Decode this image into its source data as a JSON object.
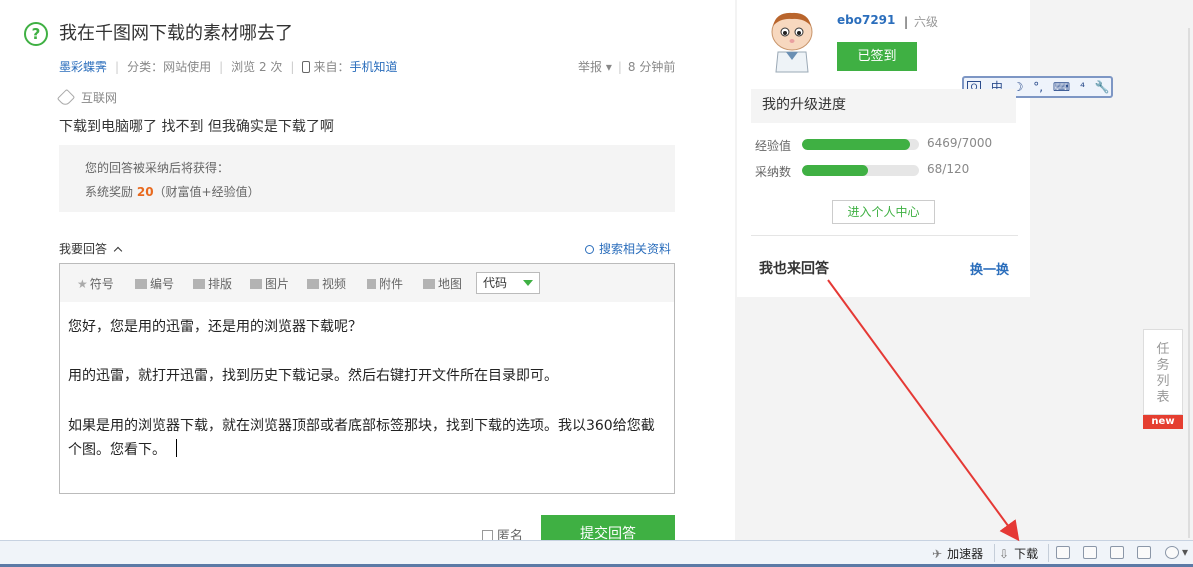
{
  "question": {
    "title": "我在千图网下载的素材哪去了",
    "author": "墨彩蝶霁",
    "category_label": "分类：",
    "category": "网站使用",
    "views": "浏览 2 次",
    "source_label": "来自：",
    "source": "手机知道",
    "report": "举报",
    "time": "8 分钟前",
    "tag": "互联网",
    "body": "下载到电脑哪了 找不到 但我确实是下载了啊"
  },
  "reward": {
    "line1": "您的回答被采纳后将获得：",
    "line2_prefix": "系统奖励",
    "points": "20",
    "line2_suffix": "（财富值+经验值）"
  },
  "answer": {
    "label": "我要回答",
    "search_related": "搜索相关资料",
    "toolbar": [
      "符号",
      "编号",
      "排版",
      "图片",
      "视频",
      "附件",
      "地图"
    ],
    "code_select": "代码",
    "lines": [
      "您好，您是用的迅雷，还是用的浏览器下载呢？",
      "用的迅雷，就打开迅雷，找到历史下载记录。然后右键打开文件所在目录即可。",
      "如果是用的浏览器下载，就在浏览器顶部或者底部标签那块，找到下载的选项。我以360给您截",
      "个图。您看下。"
    ],
    "anonymous": "匿名",
    "submit": "提交回答"
  },
  "user": {
    "name": "ebo7291",
    "level": "六级",
    "signed": "已签到"
  },
  "ime": {
    "items": [
      "中",
      "☽",
      "°,",
      "⌨",
      "⁴",
      "🔧"
    ]
  },
  "progress": {
    "title": "我的升级进度",
    "rows": [
      {
        "label": "经验值",
        "value": "6469/7000",
        "fraction": 0.924
      },
      {
        "label": "采纳数",
        "value": "68/120",
        "fraction": 0.567
      }
    ],
    "center_button": "进入个人中心"
  },
  "also": {
    "title": "我也来回答",
    "switch": "换一换"
  },
  "task_list": {
    "chars": [
      "任",
      "务",
      "列",
      "表"
    ],
    "badge": "new"
  },
  "statusbar": {
    "accelerator": "加速器",
    "download": "下载"
  },
  "colors": {
    "accent_green": "#3fb043",
    "link_blue": "#2b6ebc",
    "reward_orange": "#e86a1f",
    "arrow_red": "#e53935"
  }
}
